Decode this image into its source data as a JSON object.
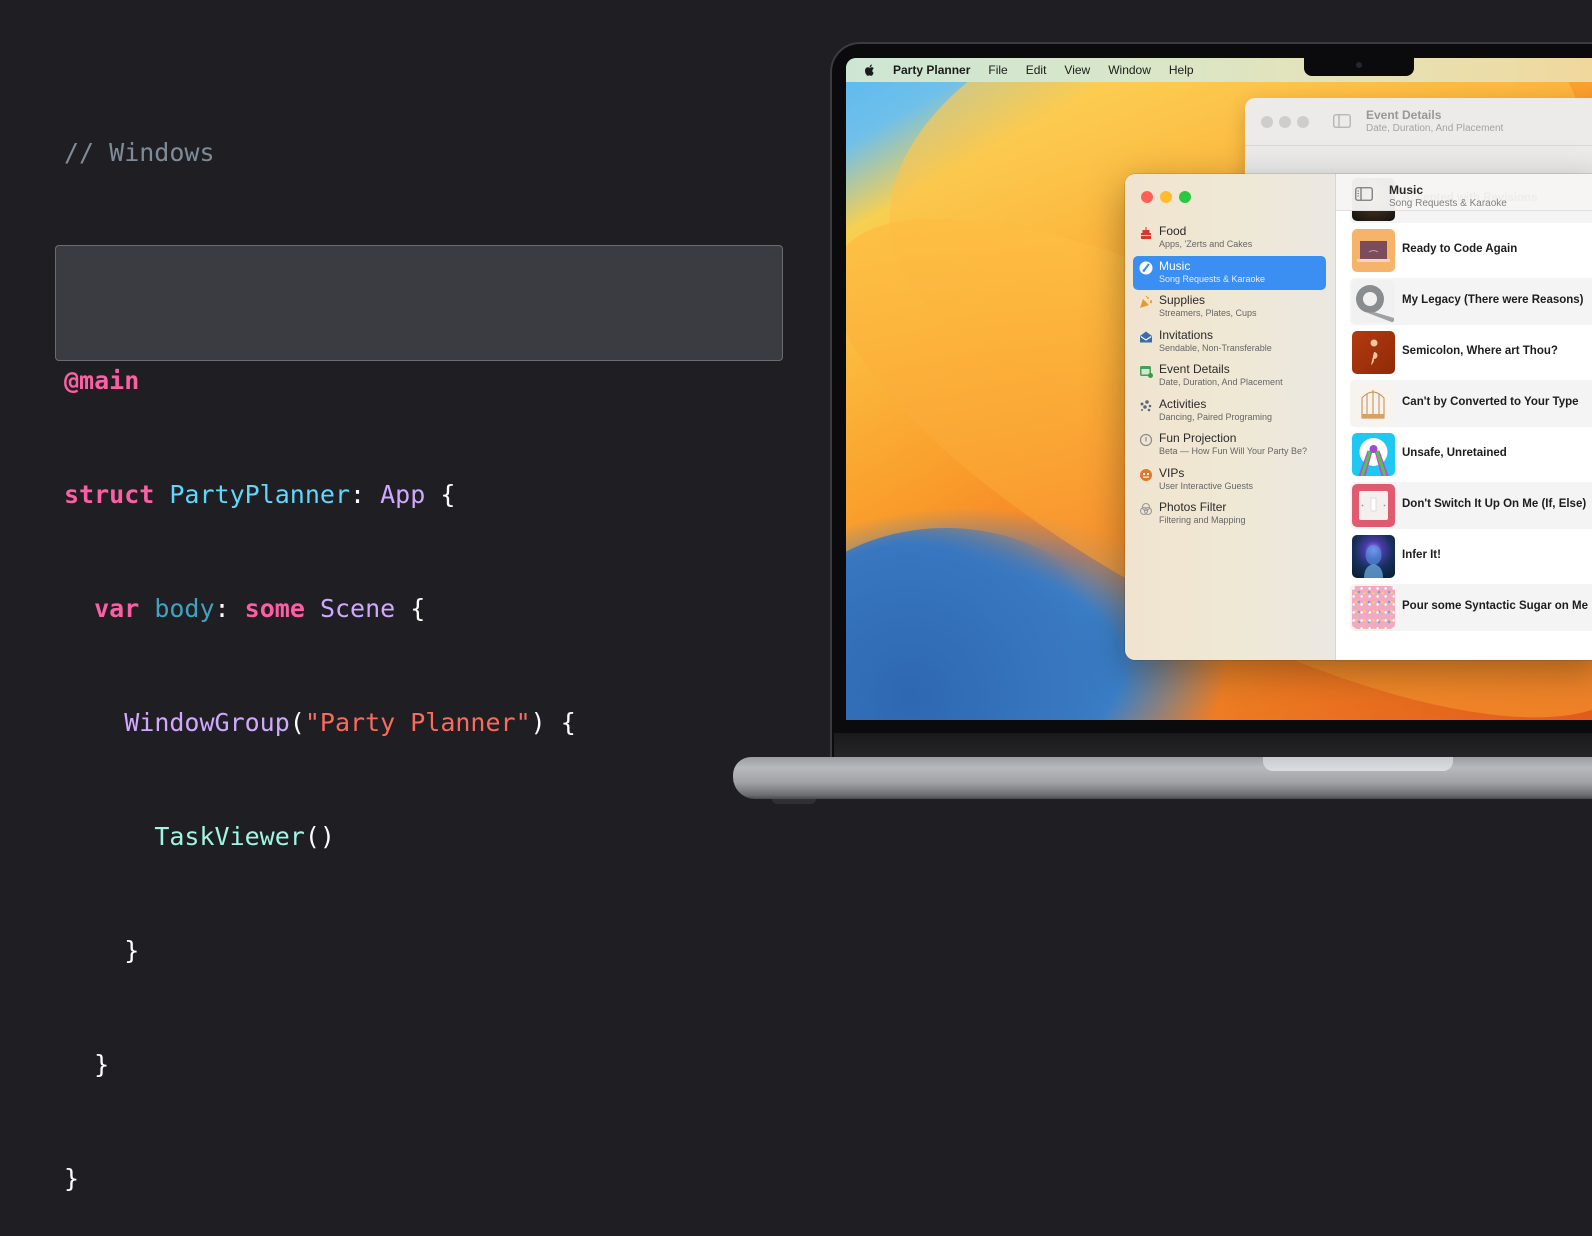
{
  "code": {
    "comment": "// Windows",
    "attribute": "@main",
    "line_struct": {
      "keyword": "struct",
      "name": "PartyPlanner",
      "colon": ":",
      "protocol": "App",
      "brace": "{"
    },
    "line_body": {
      "keyword": "var",
      "name": "body",
      "colon": ":",
      "keyword2": "some",
      "type": "Scene",
      "brace": "{"
    },
    "line_window_group": {
      "call": "WindowGroup",
      "open": "(",
      "string": "\"Party Planner\"",
      "close": ")",
      "brace": "{"
    },
    "line_task_viewer": {
      "call": "TaskViewer",
      "parens": "()"
    },
    "close_inner": "}",
    "close_body": "}",
    "close_struct": "}"
  },
  "menubar": {
    "apple_icon": "apple-logo",
    "app_name": "Party Planner",
    "items": [
      "File",
      "Edit",
      "View",
      "Window",
      "Help"
    ]
  },
  "back_window": {
    "title": "Event Details",
    "subtitle": "Date, Duration, And Placement"
  },
  "front_window": {
    "sidebar": {
      "items": [
        {
          "label": "Food",
          "sub": "Apps, 'Zerts and Cakes",
          "icon": "cake-icon",
          "glyph": "🎂",
          "color": "#d33a2c",
          "selected": false
        },
        {
          "label": "Music",
          "sub": "Song Requests & Karaoke",
          "icon": "music-icon",
          "glyph": "♪",
          "color": "#ffffff",
          "selected": true
        },
        {
          "label": "Supplies",
          "sub": "Streamers, Plates, Cups",
          "icon": "party-popper-icon",
          "glyph": "🎉",
          "color": "#e69a2c",
          "selected": false
        },
        {
          "label": "Invitations",
          "sub": "Sendable, Non-Transferable",
          "icon": "envelope-icon",
          "glyph": "✉",
          "color": "#3b6ea8",
          "selected": false
        },
        {
          "label": "Event Details",
          "sub": "Date, Duration, And Placement",
          "icon": "calendar-icon",
          "glyph": "▦",
          "color": "#4a9e5a",
          "selected": false
        },
        {
          "label": "Activities",
          "sub": "Dancing, Paired Programing",
          "icon": "activities-icon",
          "glyph": "⁂",
          "color": "#5a6a7a",
          "selected": false
        },
        {
          "label": "Fun Projection",
          "sub": "Beta — How Fun Will Your Party Be?",
          "icon": "gauge-icon",
          "glyph": "ⓘ",
          "color": "#8a8a8a",
          "selected": false
        },
        {
          "label": "VIPs",
          "sub": "User Interactive Guests",
          "icon": "vip-face-icon",
          "glyph": "●",
          "color": "#e2772a",
          "selected": false
        },
        {
          "label": "Photos Filter",
          "sub": "Filtering and Mapping",
          "icon": "photo-filter-icon",
          "glyph": "❂",
          "color": "#9a9a9a",
          "selected": false
        }
      ]
    },
    "content": {
      "title": "Music",
      "subtitle": "Song Requests & Karaoke",
      "songs": [
        {
          "title": "Accepted with Revisions",
          "art": "guitar-art",
          "bg": "#2a241c"
        },
        {
          "title": "Ready to Code Again",
          "art": "sad-laptop-art",
          "bg": "#f6b36a"
        },
        {
          "title": "My Legacy (There were Reasons)",
          "art": "duct-tape-art",
          "bg": "#eeeeee"
        },
        {
          "title": "Semicolon, Where art Thou?",
          "art": "semicolon-art",
          "bg": "#a6320c"
        },
        {
          "title": "Can't by Converted to Your Type",
          "art": "birdcage-art",
          "bg": "#f7f3ee"
        },
        {
          "title": "Unsafe, Unretained",
          "art": "rainbow-clock-art",
          "bg": "#1ec8f0"
        },
        {
          "title": "Don't Switch It Up On Me (If, Else)",
          "art": "light-switch-art",
          "bg": "#e05a70"
        },
        {
          "title": "Infer It!",
          "art": "brain-art",
          "bg": "#16305a"
        },
        {
          "title": "Pour some Syntactic Sugar on Me",
          "art": "sprinkles-art",
          "bg": "#f3a9c2"
        }
      ]
    }
  }
}
